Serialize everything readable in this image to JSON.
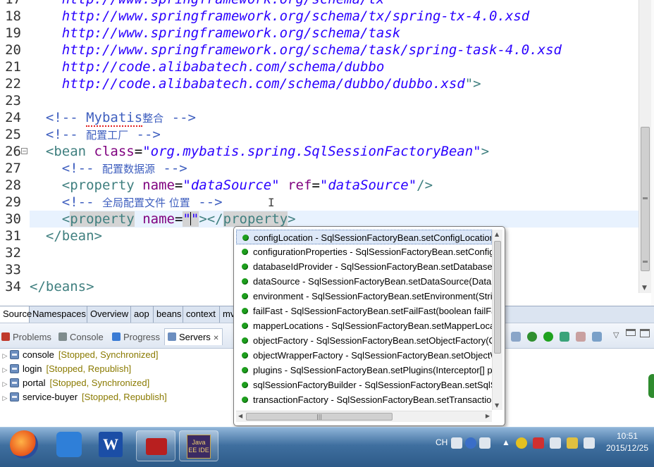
{
  "editor": {
    "lines": [
      {
        "num": "17",
        "tokens": [
          {
            "t": "http://www.springframework.org/schema/tx",
            "c": "c-url"
          }
        ]
      },
      {
        "num": "18",
        "tokens": [
          {
            "t": "http://www.springframework.org/schema/tx/spring-tx-4.0.xsd",
            "c": "c-url"
          }
        ]
      },
      {
        "num": "19",
        "tokens": [
          {
            "t": "http://www.springframework.org/schema/task",
            "c": "c-url"
          }
        ]
      },
      {
        "num": "20",
        "tokens": [
          {
            "t": "http://www.springframework.org/schema/task/spring-task-4.0.xsd",
            "c": "c-url"
          }
        ]
      },
      {
        "num": "21",
        "tokens": [
          {
            "t": "http://code.alibabatech.com/schema/dubbo",
            "c": "c-url"
          }
        ]
      },
      {
        "num": "22",
        "tokens": [
          {
            "t": "http://code.alibabatech.com/schema/dubbo/dubbo.xsd",
            "c": "c-url"
          },
          {
            "t": "\">",
            "c": "c-tag"
          }
        ]
      },
      {
        "num": "23",
        "tokens": []
      },
      {
        "num": "24",
        "tokens": [
          {
            "t": "<!-- ",
            "c": "c-cmt"
          },
          {
            "t": "Mybatis",
            "c": "c-cmt squig"
          },
          {
            "t": "整合",
            "c": "c-cmt cj"
          },
          {
            "t": " -->",
            "c": "c-cmt"
          }
        ]
      },
      {
        "num": "25",
        "tokens": [
          {
            "t": "<!-- ",
            "c": "c-cmt"
          },
          {
            "t": "配置工厂",
            "c": "c-cmt cj"
          },
          {
            "t": " -->",
            "c": "c-cmt"
          }
        ]
      },
      {
        "num": "26",
        "tokens": [
          {
            "t": "<bean ",
            "c": "c-tag"
          },
          {
            "t": "class",
            "c": "c-attr"
          },
          {
            "t": "=",
            "c": "c-plain"
          },
          {
            "t": "\"org.mybatis.spring.SqlSessionFactoryBean\"",
            "c": "c-val"
          },
          {
            "t": ">",
            "c": "c-tag"
          }
        ]
      },
      {
        "num": "27",
        "tokens": [
          {
            "t": "<!-- ",
            "c": "c-cmt"
          },
          {
            "t": "配置数据源",
            "c": "c-cmt cj"
          },
          {
            "t": " -->",
            "c": "c-cmt"
          }
        ]
      },
      {
        "num": "28",
        "tokens": [
          {
            "t": "<property ",
            "c": "c-tag"
          },
          {
            "t": "name",
            "c": "c-attr"
          },
          {
            "t": "=",
            "c": "c-plain"
          },
          {
            "t": "\"dataSource\"",
            "c": "c-val"
          },
          {
            "t": " ",
            "c": "c-plain"
          },
          {
            "t": "ref",
            "c": "c-attr"
          },
          {
            "t": "=",
            "c": "c-plain"
          },
          {
            "t": "\"dataSource\"",
            "c": "c-val"
          },
          {
            "t": "/>",
            "c": "c-tag"
          }
        ]
      },
      {
        "num": "29",
        "tokens": [
          {
            "t": "<!-- ",
            "c": "c-cmt"
          },
          {
            "t": "全局配置文件 位置",
            "c": "c-cmt cj"
          },
          {
            "t": " -->",
            "c": "c-cmt"
          }
        ]
      },
      {
        "num": "30",
        "tokens": [
          {
            "t": "<",
            "c": "c-tag"
          },
          {
            "t": "property",
            "c": "c-tag c-hl"
          },
          {
            "t": " ",
            "c": "c-plain"
          },
          {
            "t": "name",
            "c": "c-attr"
          },
          {
            "t": "=",
            "c": "c-plain"
          },
          {
            "t": "\"",
            "c": "c-val c-hl"
          },
          {
            "t": "|",
            "c": "caret"
          },
          {
            "t": "\"",
            "c": "c-val c-hl"
          },
          {
            "t": "></",
            "c": "c-tag"
          },
          {
            "t": "property",
            "c": "c-tag c-hl"
          },
          {
            "t": ">",
            "c": "c-tag"
          }
        ]
      },
      {
        "num": "31",
        "tokens": [
          {
            "t": "</bean>",
            "c": "c-tag"
          }
        ]
      },
      {
        "num": "32",
        "tokens": []
      },
      {
        "num": "33",
        "tokens": []
      },
      {
        "num": "34",
        "tokens": [
          {
            "t": "</beans>",
            "c": "c-tag"
          }
        ]
      }
    ]
  },
  "editor_tabs": [
    "Source",
    "Namespaces",
    "Overview",
    "aop",
    "beans",
    "context",
    "mv"
  ],
  "panel": {
    "tabs": [
      {
        "label": "Problems",
        "icon": "problems-icon",
        "color": "#c0392b"
      },
      {
        "label": "Console",
        "icon": "console-icon",
        "color": "#7f8c8d"
      },
      {
        "label": "Progress",
        "icon": "progress-icon",
        "color": "#3a7bd5"
      },
      {
        "label": "Servers",
        "icon": "servers-icon",
        "color": "#6c8ebf",
        "active": true
      }
    ],
    "close_glyph": "✕",
    "servers": [
      {
        "name": "console",
        "status": "[Stopped, Synchronized]"
      },
      {
        "name": "login",
        "status": "[Stopped, Republish]"
      },
      {
        "name": "portal",
        "status": "[Stopped, Synchronized]"
      },
      {
        "name": "service-buyer",
        "status": "[Stopped, Republish]"
      }
    ]
  },
  "completion": {
    "items": [
      "configLocation - SqlSessionFactoryBean.setConfigLocation(Resource",
      "configurationProperties - SqlSessionFactoryBean.setConfigurationProperties",
      "databaseIdProvider - SqlSessionFactoryBean.setDatabaseIdProvider",
      "dataSource - SqlSessionFactoryBean.setDataSource(DataSource",
      "environment - SqlSessionFactoryBean.setEnvironment(String",
      "failFast - SqlSessionFactoryBean.setFailFast(boolean failFast",
      "mapperLocations - SqlSessionFactoryBean.setMapperLocations",
      "objectFactory - SqlSessionFactoryBean.setObjectFactory(ObjectFactory",
      "objectWrapperFactory - SqlSessionFactoryBean.setObjectWrapperFactory",
      "plugins - SqlSessionFactoryBean.setPlugins(Interceptor[] plugins",
      "sqlSessionFactoryBuilder - SqlSessionFactoryBean.setSqlSessionFactoryBuilder",
      "transactionFactory - SqlSessionFactoryBean.setTransactionFactory"
    ],
    "selected_index": 0
  },
  "taskbar": {
    "lang": "CH",
    "time": "10:51",
    "date": "2015/12/25",
    "javaee_label": "Java EE IDE"
  },
  "colors": {
    "url": "#2a00ff",
    "comment": "#3f5fbf",
    "tag": "#3f7f7f",
    "attr": "#7f007f",
    "current_line": "#e8f2fe",
    "status": "#8a7a00"
  }
}
